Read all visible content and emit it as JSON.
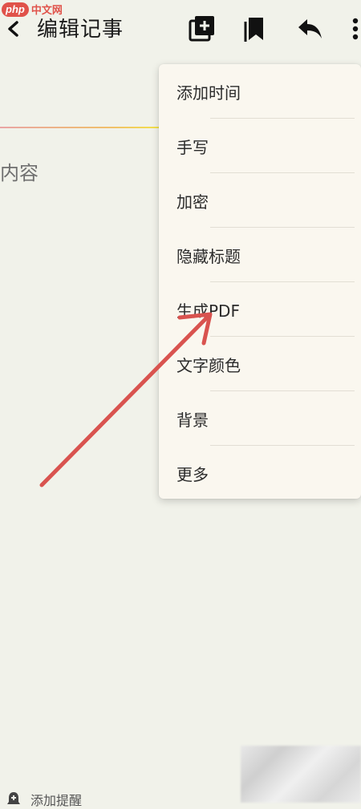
{
  "watermark": {
    "logo": "php",
    "text": "中文网"
  },
  "header": {
    "title": "编辑记事",
    "icons": {
      "back": "chevron-left-icon",
      "add_note": "add-note-icon",
      "bookmark": "bookmark-icon",
      "reply": "reply-icon",
      "more": "more-vertical-icon"
    }
  },
  "editor": {
    "content_placeholder": "内容"
  },
  "menu": {
    "items": [
      {
        "label": "添加时间"
      },
      {
        "label": "手写"
      },
      {
        "label": "加密"
      },
      {
        "label": "隐藏标题"
      },
      {
        "label": "生成PDF"
      },
      {
        "label": "文字颜色"
      },
      {
        "label": "背景"
      },
      {
        "label": "更多"
      }
    ]
  },
  "footer": {
    "reminder_label": "添加提醒"
  },
  "colors": {
    "background": "#f1f2ea",
    "menu_background": "#faf7ef",
    "annotation_arrow": "#d9534f"
  }
}
